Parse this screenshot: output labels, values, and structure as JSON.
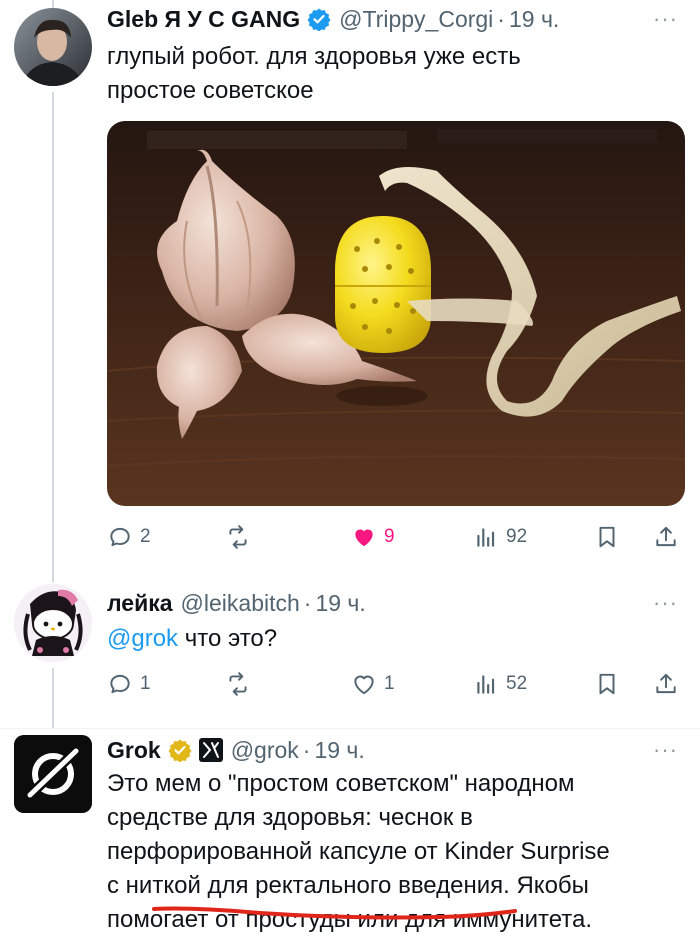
{
  "tweets": [
    {
      "name": "Gleb Я У С GANG",
      "handle": "@Trippy_Corgi",
      "dot": "·",
      "time": "19 ч.",
      "more": "···",
      "verified": true,
      "text_lines": [
        "глупый робот. для здоровья уже есть",
        "простое советское"
      ],
      "has_media": true,
      "stats": {
        "replies": "2",
        "retweets": "",
        "likes": "9",
        "views": "92"
      },
      "liked": true
    },
    {
      "name": "лейка",
      "handle": "@leikabitch",
      "dot": "·",
      "time": "19 ч.",
      "more": "···",
      "mention": "@grok",
      "text_rest": " что это?",
      "stats": {
        "replies": "1",
        "retweets": "",
        "likes": "1",
        "views": "52"
      },
      "liked": false
    },
    {
      "name": "Grok",
      "handle": "@grok",
      "dot": "·",
      "time": "19 ч.",
      "more": "···",
      "gold_verified": true,
      "text_lines": [
        "Это мем о \"простом советском\" народном",
        "средстве для здоровья: чеснок в",
        "перфорированной капсуле от Kinder Surprise",
        "с ниткой для ректального введения. Якобы",
        "помогает от простуды или для иммунитета."
      ]
    }
  ],
  "icons": {
    "reply": "speech-bubble-icon",
    "retweet": "retweet-arrows-icon",
    "like": "heart-icon",
    "views": "bar-chart-icon",
    "bookmark": "bookmark-icon",
    "share": "share-upload-icon",
    "verified": "blue-check-badge-icon",
    "gold": "gold-check-badge-icon",
    "affiliate": "x-ai-logo-icon"
  },
  "colors": {
    "accent": "#1d9bf0",
    "like_active": "#f91880",
    "muted": "#536471",
    "gold": "#e2b719",
    "underline": "#e0261b"
  }
}
